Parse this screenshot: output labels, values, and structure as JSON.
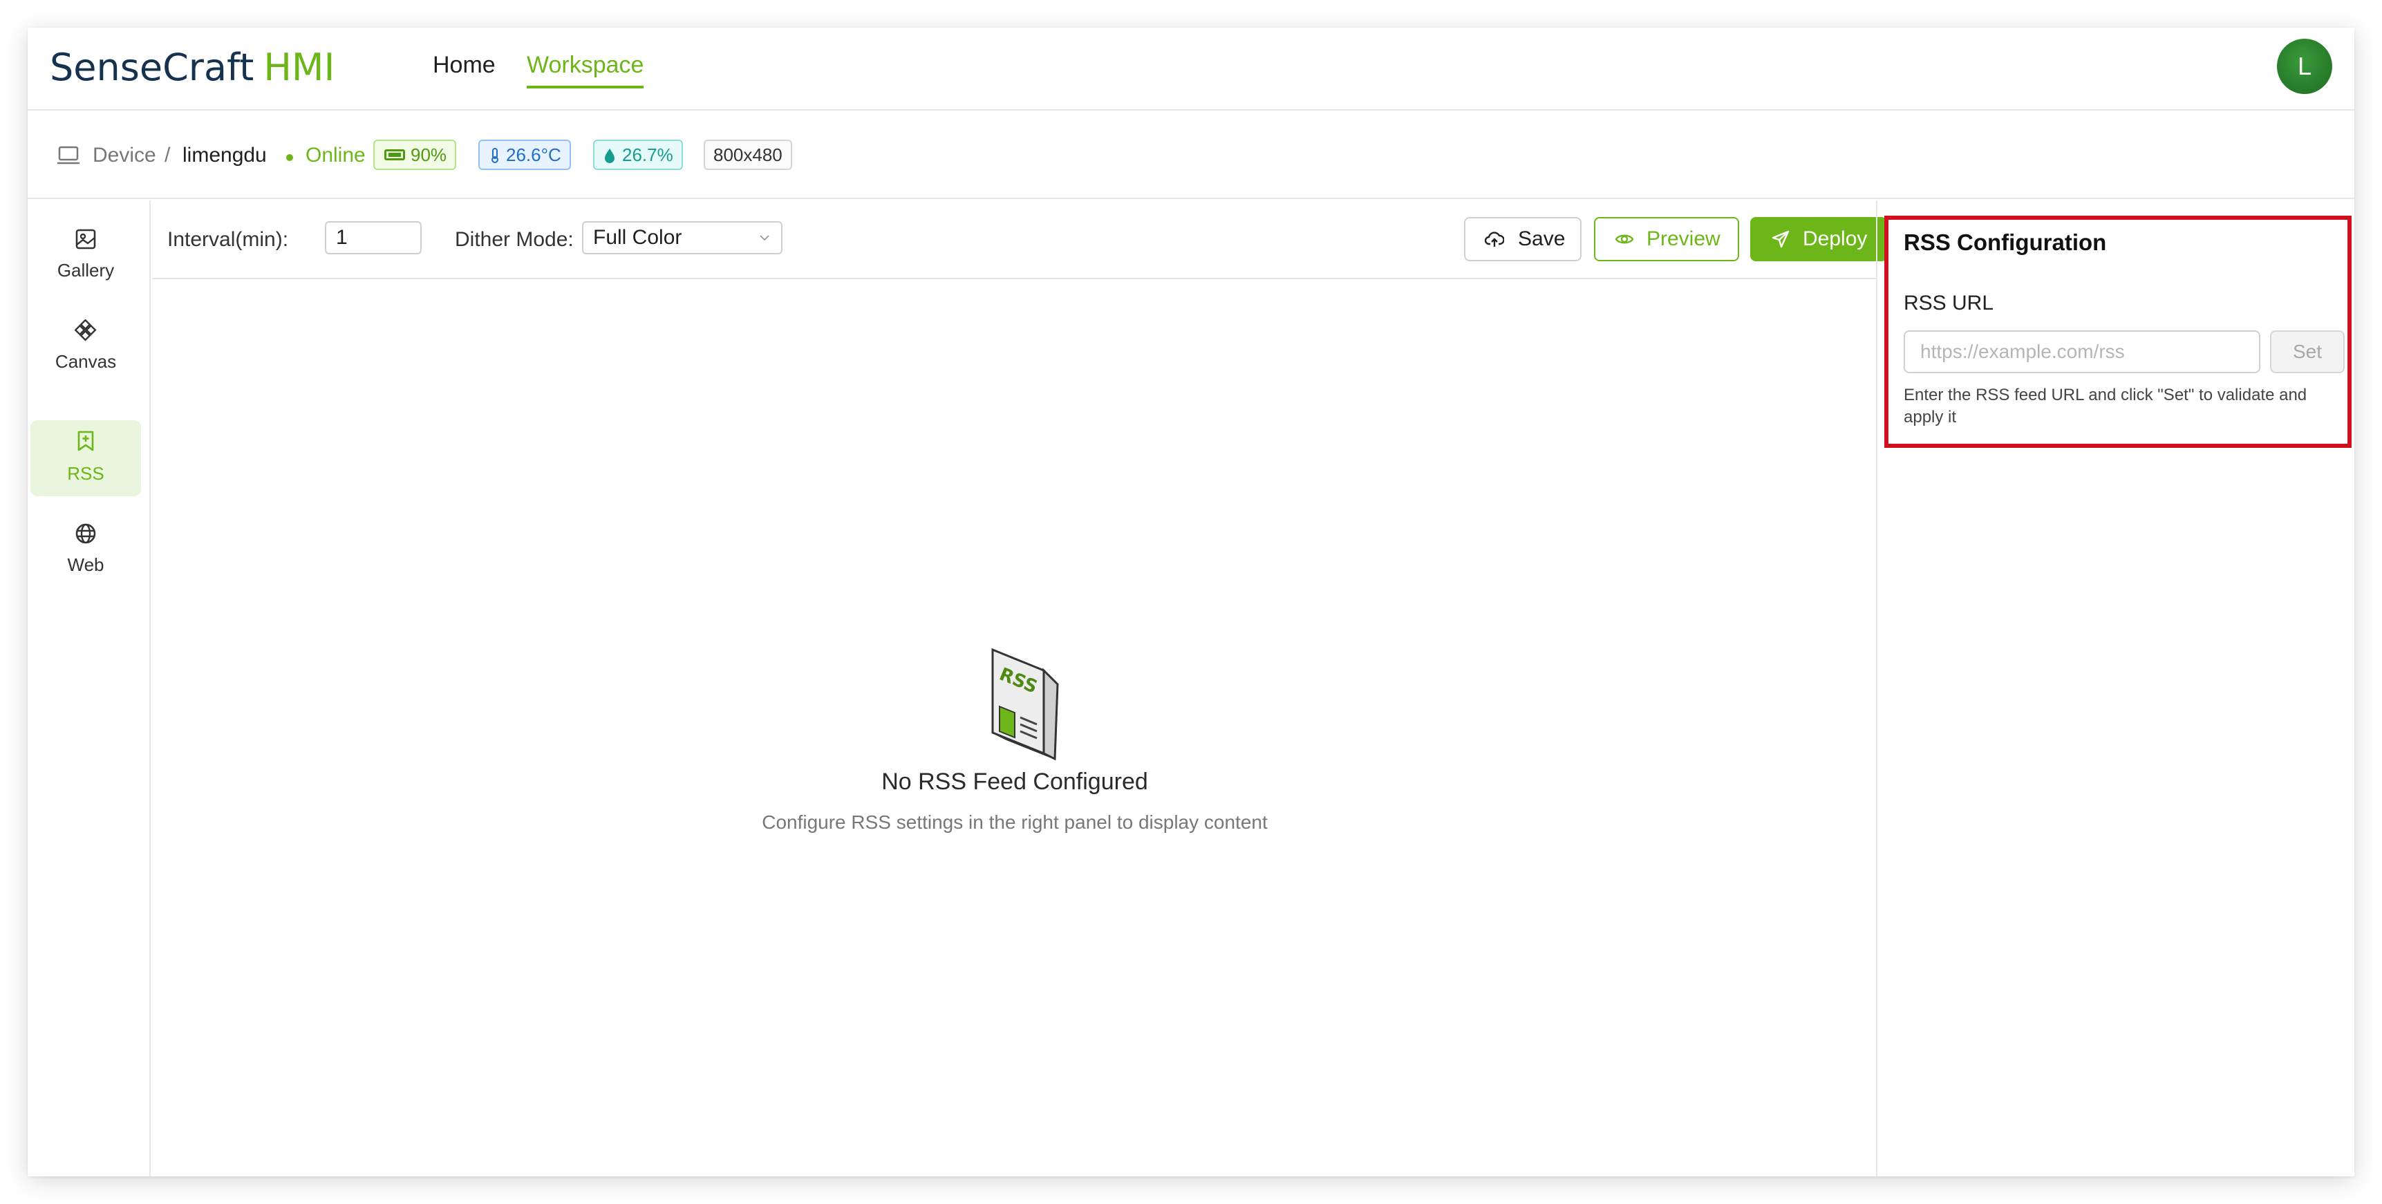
{
  "header": {
    "logo_part1": "SenseCraft",
    "logo_part2": "HMI",
    "nav": {
      "home": "Home",
      "workspace": "Workspace"
    },
    "avatar_initial": "L"
  },
  "device_bar": {
    "device_label": "Device",
    "separator": "/",
    "device_name": "limengdu",
    "status": "Online",
    "battery": "90%",
    "temperature": "26.6°C",
    "humidity": "26.7%",
    "resolution": "800x480"
  },
  "sidebar": {
    "items": [
      {
        "label": "Gallery",
        "icon": "image-icon"
      },
      {
        "label": "Canvas",
        "icon": "diamond-grid-icon"
      },
      {
        "label": "RSS",
        "icon": "bookmark-plus-icon"
      },
      {
        "label": "Web",
        "icon": "globe-icon"
      }
    ],
    "active": "RSS"
  },
  "toolbar": {
    "interval_label": "Interval(min):",
    "interval_value": "1",
    "dither_label": "Dither Mode:",
    "dither_value": "Full Color",
    "save_label": "Save",
    "preview_label": "Preview",
    "deploy_label": "Deploy"
  },
  "empty_state": {
    "title": "No RSS Feed Configured",
    "subtitle": "Configure RSS settings in the right panel to display content",
    "illustration_text": "RSS"
  },
  "rss_config": {
    "title": "RSS Configuration",
    "url_label": "RSS URL",
    "url_value": "",
    "url_placeholder": "https://example.com/rss",
    "set_label": "Set",
    "help_text": "Enter the RSS feed URL and click \"Set\" to validate and apply it"
  },
  "colors": {
    "accent": "#6db619",
    "brand_dark": "#16324f",
    "highlight_border": "#d0101c"
  }
}
